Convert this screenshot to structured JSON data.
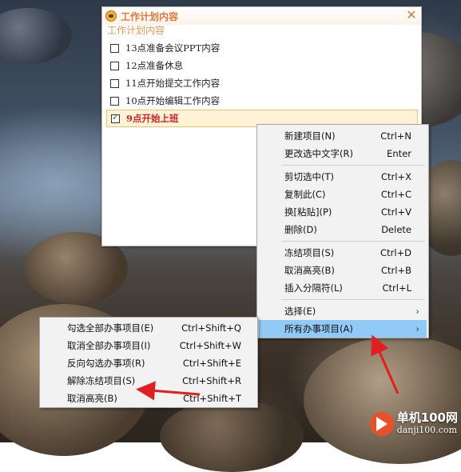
{
  "window": {
    "title": "工作计划内容",
    "subtitle": "工作计划内容",
    "close_glyph": "✕",
    "items": [
      {
        "label": "13点准备会议PPT内容",
        "checked": false
      },
      {
        "label": "12点准备休息",
        "checked": false
      },
      {
        "label": "11点开始提交工作内容",
        "checked": false
      },
      {
        "label": "10点开始编辑工作内容",
        "checked": false
      },
      {
        "label": "9点开始上班",
        "checked": true,
        "highlighted": true
      }
    ]
  },
  "context_menu": {
    "items": [
      {
        "label": "新建项目(N)",
        "shortcut": "Ctrl+N"
      },
      {
        "label": "更改选中文字(R)",
        "shortcut": "Enter"
      },
      {
        "label": "剪切选中(T)",
        "shortcut": "Ctrl+X"
      },
      {
        "label": "复制此(C)",
        "shortcut": "Ctrl+C"
      },
      {
        "label": "换[粘贴](P)",
        "shortcut": "Ctrl+V"
      },
      {
        "label": "删除(D)",
        "shortcut": "Delete"
      },
      {
        "label": "冻结项目(S)",
        "shortcut": "Ctrl+D"
      },
      {
        "label": "取消高亮(B)",
        "shortcut": "Ctrl+B"
      },
      {
        "label": "插入分隔符(L)",
        "shortcut": "Ctrl+L"
      },
      {
        "label": "选择(E)",
        "submenu": true
      },
      {
        "label": "所有办事项目(A)",
        "submenu": true,
        "highlighted": true
      }
    ],
    "arrow_glyph": "›"
  },
  "submenu": {
    "items": [
      {
        "label": "勾选全部办事项目(E)",
        "shortcut": "Ctrl+Shift+Q"
      },
      {
        "label": "取消全部办事项目(I)",
        "shortcut": "Ctrl+Shift+W"
      },
      {
        "label": "反向勾选办事项(R)",
        "shortcut": "Ctrl+Shift+E"
      },
      {
        "label": "解除冻结项目(S)",
        "shortcut": "Ctrl+Shift+R"
      },
      {
        "label": "取消高亮(B)",
        "shortcut": "Ctrl+Shift+T"
      }
    ]
  },
  "watermark": {
    "name": "单机100网",
    "domain": "danji100.com"
  },
  "colors": {
    "accent": "#e0783a",
    "highlight_row": "#fff2d6",
    "menu_highlight": "#91c9f7",
    "annotation_arrow": "#e02020",
    "active_text": "#d42020"
  }
}
